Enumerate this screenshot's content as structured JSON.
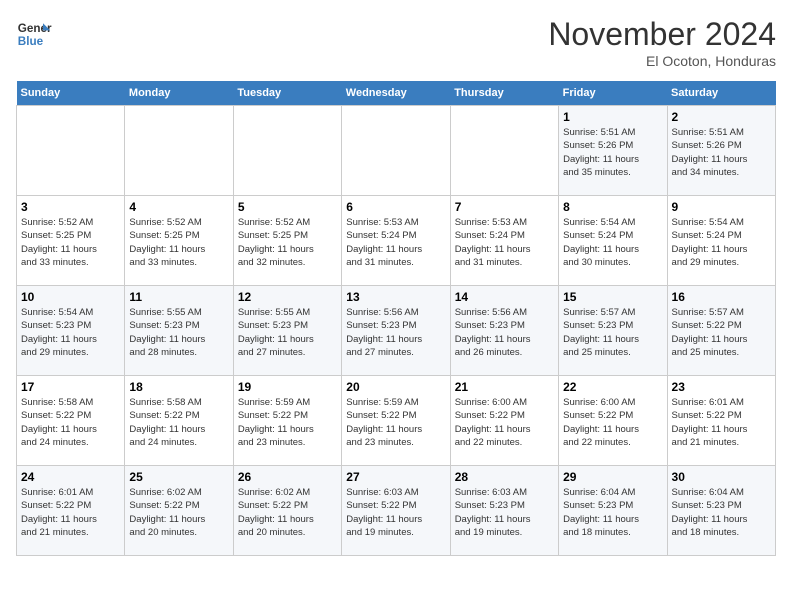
{
  "header": {
    "logo_line1": "General",
    "logo_line2": "Blue",
    "month": "November 2024",
    "location": "El Ocoton, Honduras"
  },
  "weekdays": [
    "Sunday",
    "Monday",
    "Tuesday",
    "Wednesday",
    "Thursday",
    "Friday",
    "Saturday"
  ],
  "weeks": [
    [
      {
        "day": "",
        "info": ""
      },
      {
        "day": "",
        "info": ""
      },
      {
        "day": "",
        "info": ""
      },
      {
        "day": "",
        "info": ""
      },
      {
        "day": "",
        "info": ""
      },
      {
        "day": "1",
        "info": "Sunrise: 5:51 AM\nSunset: 5:26 PM\nDaylight: 11 hours\nand 35 minutes."
      },
      {
        "day": "2",
        "info": "Sunrise: 5:51 AM\nSunset: 5:26 PM\nDaylight: 11 hours\nand 34 minutes."
      }
    ],
    [
      {
        "day": "3",
        "info": "Sunrise: 5:52 AM\nSunset: 5:25 PM\nDaylight: 11 hours\nand 33 minutes."
      },
      {
        "day": "4",
        "info": "Sunrise: 5:52 AM\nSunset: 5:25 PM\nDaylight: 11 hours\nand 33 minutes."
      },
      {
        "day": "5",
        "info": "Sunrise: 5:52 AM\nSunset: 5:25 PM\nDaylight: 11 hours\nand 32 minutes."
      },
      {
        "day": "6",
        "info": "Sunrise: 5:53 AM\nSunset: 5:24 PM\nDaylight: 11 hours\nand 31 minutes."
      },
      {
        "day": "7",
        "info": "Sunrise: 5:53 AM\nSunset: 5:24 PM\nDaylight: 11 hours\nand 31 minutes."
      },
      {
        "day": "8",
        "info": "Sunrise: 5:54 AM\nSunset: 5:24 PM\nDaylight: 11 hours\nand 30 minutes."
      },
      {
        "day": "9",
        "info": "Sunrise: 5:54 AM\nSunset: 5:24 PM\nDaylight: 11 hours\nand 29 minutes."
      }
    ],
    [
      {
        "day": "10",
        "info": "Sunrise: 5:54 AM\nSunset: 5:23 PM\nDaylight: 11 hours\nand 29 minutes."
      },
      {
        "day": "11",
        "info": "Sunrise: 5:55 AM\nSunset: 5:23 PM\nDaylight: 11 hours\nand 28 minutes."
      },
      {
        "day": "12",
        "info": "Sunrise: 5:55 AM\nSunset: 5:23 PM\nDaylight: 11 hours\nand 27 minutes."
      },
      {
        "day": "13",
        "info": "Sunrise: 5:56 AM\nSunset: 5:23 PM\nDaylight: 11 hours\nand 27 minutes."
      },
      {
        "day": "14",
        "info": "Sunrise: 5:56 AM\nSunset: 5:23 PM\nDaylight: 11 hours\nand 26 minutes."
      },
      {
        "day": "15",
        "info": "Sunrise: 5:57 AM\nSunset: 5:23 PM\nDaylight: 11 hours\nand 25 minutes."
      },
      {
        "day": "16",
        "info": "Sunrise: 5:57 AM\nSunset: 5:22 PM\nDaylight: 11 hours\nand 25 minutes."
      }
    ],
    [
      {
        "day": "17",
        "info": "Sunrise: 5:58 AM\nSunset: 5:22 PM\nDaylight: 11 hours\nand 24 minutes."
      },
      {
        "day": "18",
        "info": "Sunrise: 5:58 AM\nSunset: 5:22 PM\nDaylight: 11 hours\nand 24 minutes."
      },
      {
        "day": "19",
        "info": "Sunrise: 5:59 AM\nSunset: 5:22 PM\nDaylight: 11 hours\nand 23 minutes."
      },
      {
        "day": "20",
        "info": "Sunrise: 5:59 AM\nSunset: 5:22 PM\nDaylight: 11 hours\nand 23 minutes."
      },
      {
        "day": "21",
        "info": "Sunrise: 6:00 AM\nSunset: 5:22 PM\nDaylight: 11 hours\nand 22 minutes."
      },
      {
        "day": "22",
        "info": "Sunrise: 6:00 AM\nSunset: 5:22 PM\nDaylight: 11 hours\nand 22 minutes."
      },
      {
        "day": "23",
        "info": "Sunrise: 6:01 AM\nSunset: 5:22 PM\nDaylight: 11 hours\nand 21 minutes."
      }
    ],
    [
      {
        "day": "24",
        "info": "Sunrise: 6:01 AM\nSunset: 5:22 PM\nDaylight: 11 hours\nand 21 minutes."
      },
      {
        "day": "25",
        "info": "Sunrise: 6:02 AM\nSunset: 5:22 PM\nDaylight: 11 hours\nand 20 minutes."
      },
      {
        "day": "26",
        "info": "Sunrise: 6:02 AM\nSunset: 5:22 PM\nDaylight: 11 hours\nand 20 minutes."
      },
      {
        "day": "27",
        "info": "Sunrise: 6:03 AM\nSunset: 5:22 PM\nDaylight: 11 hours\nand 19 minutes."
      },
      {
        "day": "28",
        "info": "Sunrise: 6:03 AM\nSunset: 5:23 PM\nDaylight: 11 hours\nand 19 minutes."
      },
      {
        "day": "29",
        "info": "Sunrise: 6:04 AM\nSunset: 5:23 PM\nDaylight: 11 hours\nand 18 minutes."
      },
      {
        "day": "30",
        "info": "Sunrise: 6:04 AM\nSunset: 5:23 PM\nDaylight: 11 hours\nand 18 minutes."
      }
    ]
  ]
}
